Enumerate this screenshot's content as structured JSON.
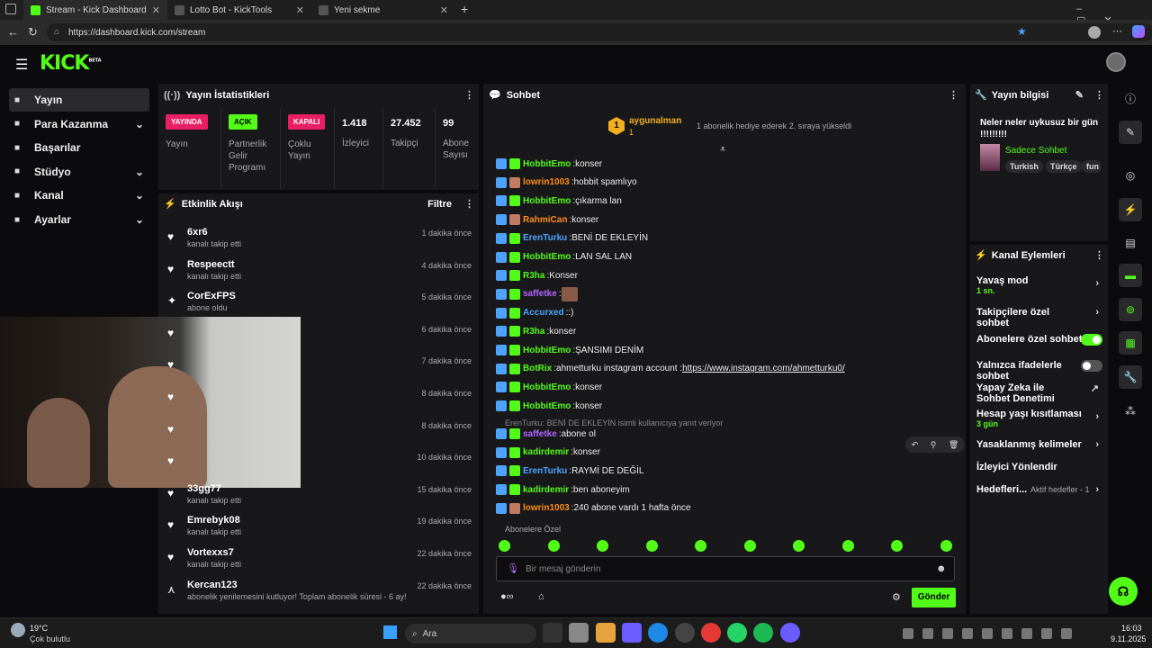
{
  "tabs": [
    {
      "title": "Stream - Kick Dashboard",
      "fav": "#53fc18"
    },
    {
      "title": "Lotto Bot - KickTools",
      "fav": "#555"
    },
    {
      "title": "Yeni sekme",
      "fav": "#555"
    }
  ],
  "address": "https://dashboard.kick.com/stream",
  "app": {
    "logo": "KICK",
    "beta": "BETA"
  },
  "sidebar": [
    {
      "label": "Yayın",
      "icon": "broadcast-icon"
    },
    {
      "label": "Para Kazanma",
      "icon": "money-icon"
    },
    {
      "label": "Başarılar",
      "icon": "trophy-icon"
    },
    {
      "label": "Stüdyo",
      "icon": "studio-icon"
    },
    {
      "label": "Kanal",
      "icon": "channel-icon"
    },
    {
      "label": "Ayarlar",
      "icon": "gear-icon"
    }
  ],
  "stats": {
    "title": "Yayın İstatistikleri",
    "items": [
      {
        "badge": "YAYINDA",
        "badge_color": "#e91e63",
        "label": "Yayın"
      },
      {
        "badge": "AÇIK",
        "badge_color": "#53fc18",
        "label": "Partnerlik Gelir Programı"
      },
      {
        "badge": "KAPALI",
        "badge_color": "#e91e63",
        "label": "Çoklu Yayın"
      },
      {
        "value": "1.418",
        "label": "İzleyici"
      },
      {
        "value": "27.452",
        "label": "Takipçi"
      },
      {
        "value": "99",
        "label": "Abone Sayısı"
      }
    ]
  },
  "events": {
    "title": "Etkinlik Akışı",
    "filter": "Filtre",
    "items": [
      {
        "name": "6xr6",
        "sub": "kanalı takip etti",
        "time": "1 dakika önce"
      },
      {
        "name": "Respeectt",
        "sub": "kanalı takip etti",
        "time": "4 dakika önce"
      },
      {
        "name": "CorExFPS",
        "sub": "abone oldu",
        "time": "5 dakika önce"
      },
      {
        "name": "",
        "sub": "",
        "time": "6 dakika önce"
      },
      {
        "name": "",
        "sub": "",
        "time": "7 dakika önce"
      },
      {
        "name": "",
        "sub": "",
        "time": "8 dakika önce"
      },
      {
        "name": "",
        "sub": "",
        "time": "8 dakika önce"
      },
      {
        "name": "",
        "sub": "",
        "time": "10 dakika önce"
      },
      {
        "name": "33gg77",
        "sub": "kanalı takip etti",
        "time": "15 dakika önce"
      },
      {
        "name": "Emrebyk08",
        "sub": "kanalı takip etti",
        "time": "19 dakika önce"
      },
      {
        "name": "Vortexxs7",
        "sub": "kanalı takip etti",
        "time": "22 dakika önce"
      },
      {
        "name": "Kercan123",
        "sub": "abonelik yenilemesini kutluyor! Toplam abonelik süresi - 6 ay!",
        "time": "22 dakika önce"
      }
    ]
  },
  "chat": {
    "title": "Sohbet",
    "pinned_user": "aygunalman",
    "pinned_count": "1",
    "pinned_text": "1 abonelik hediye ederek 2. sıraya yükseldi",
    "messages": [
      {
        "u": "HobbitEmo",
        "c": "#53fc18",
        "t": "konser"
      },
      {
        "u": "lowrin1003",
        "c": "#ff8c1a",
        "t": "hobbit spamlıyo"
      },
      {
        "u": "HobbitEmo",
        "c": "#53fc18",
        "t": "çıkarma lan"
      },
      {
        "u": "RahmiCan",
        "c": "#ff8c1a",
        "t": "konser"
      },
      {
        "u": "ErenTurku",
        "c": "#4ea3ff",
        "t": "BENİ DE EKLEYİN"
      },
      {
        "u": "HobbitEmo",
        "c": "#53fc18",
        "t": "LAN SAL LAN"
      },
      {
        "u": "R3ha",
        "c": "#53fc18",
        "t": "Konser"
      },
      {
        "u": "saffetke",
        "c": "#b266ff",
        "t": ""
      },
      {
        "u": "Accurxed",
        "c": "#4ea3ff",
        "t": ":)"
      },
      {
        "u": "R3ha",
        "c": "#53fc18",
        "t": "konser"
      },
      {
        "u": "HobbitEmo",
        "c": "#53fc18",
        "t": "ŞANSIMI DENİM"
      },
      {
        "u": "BotRix",
        "c": "#53fc18",
        "t": "ahmetturku instagram account : ",
        "link": "https://www.instagram.com/ahmetturku0/"
      },
      {
        "u": "HobbitEmo",
        "c": "#53fc18",
        "t": "konser"
      },
      {
        "u": "HobbitEmo",
        "c": "#53fc18",
        "t": "konser"
      }
    ],
    "reply_note": "ErenTurku: BENİ DE EKLEYİN isimli kullanıcıya yanıt veriyor",
    "messages2": [
      {
        "u": "saffetke",
        "c": "#b266ff",
        "t": "abone ol"
      },
      {
        "u": "kadirdemir",
        "c": "#53fc18",
        "t": "konser"
      },
      {
        "u": "ErenTurku",
        "c": "#4ea3ff",
        "t": "RAYMİ DE DEĞİL"
      },
      {
        "u": "kadirdemir",
        "c": "#53fc18",
        "t": "ben aboneyim"
      },
      {
        "u": "lowrin1003",
        "c": "#ff8c1a",
        "t": "240 abone vardı 1 hafta önce"
      }
    ],
    "sub_only": "Abonelere Özel",
    "placeholder": "Bir mesaj gönderin",
    "send": "Gönder"
  },
  "stream_info": {
    "title": "Yayın bilgisi",
    "stream_title": "Neler neler uykusuz bir gün !!!!!!!!!",
    "category": "Sadece Sohbet",
    "tags": [
      "Turkish",
      "Türkçe",
      "fun"
    ]
  },
  "actions": {
    "title": "Kanal Eylemleri",
    "items": [
      {
        "label": "Yavaş mod",
        "sub": "1 sn.",
        "type": "chev"
      },
      {
        "label": "Takipçilere özel sohbet",
        "type": "chev"
      },
      {
        "label": "Abonelere özel sohbet",
        "type": "on"
      },
      {
        "label": "Yalnızca ifadelerle sohbet",
        "type": "off"
      },
      {
        "label": "Yapay Zeka ile Sohbet Denetimi",
        "type": "ext"
      },
      {
        "label": "Hesap yaşı kısıtlaması",
        "sub": "3 gün",
        "type": "chev"
      },
      {
        "label": "Yasaklanmış kelimeler",
        "type": "chev"
      },
      {
        "label": "İzleyici Yönlendir",
        "type": "none"
      },
      {
        "label": "Hedefleri...",
        "sub2": "Aktif hedefler - 1",
        "type": "chev"
      }
    ]
  },
  "taskbar": {
    "temp": "19°C",
    "weather": "Çok bulutlu",
    "search": "Ara",
    "time": "16:03",
    "date": "9.11.2025"
  }
}
